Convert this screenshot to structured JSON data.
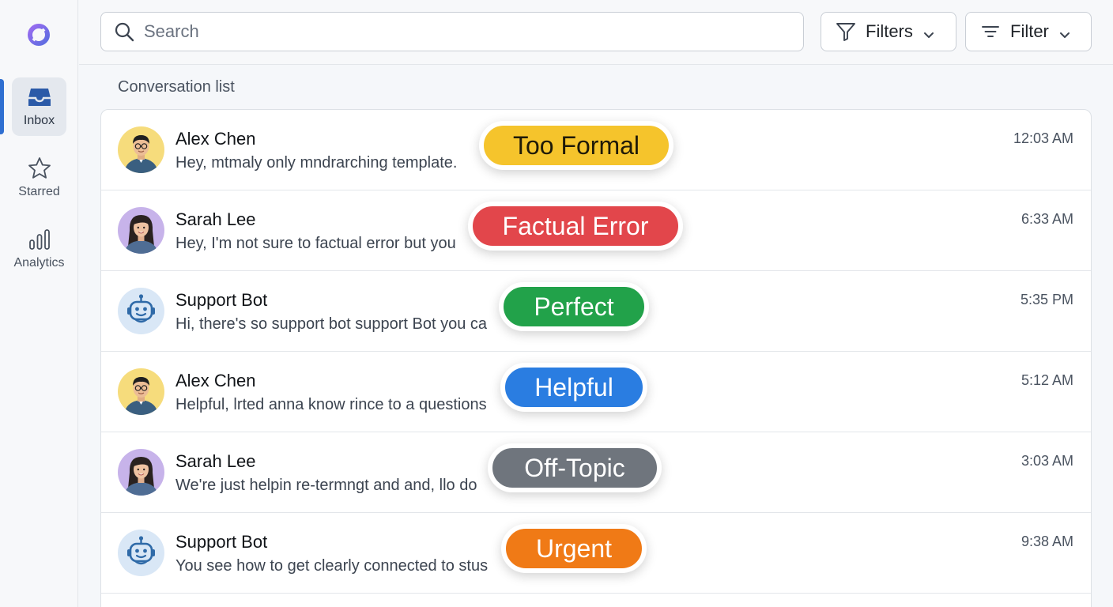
{
  "sidebar": {
    "items": [
      {
        "label": "Inbox"
      },
      {
        "label": "Starred"
      },
      {
        "label": "Analytics"
      }
    ]
  },
  "topbar": {
    "search_placeholder": "Search",
    "filters_label": "Filters",
    "filter_label": "Filter"
  },
  "main": {
    "section_title": "Conversation list",
    "conversations": [
      {
        "name": "Alex Chen",
        "preview": "Hey, mtmaly only mndrarching template.",
        "time": "12:03 AM",
        "tag": "Too Formal",
        "tag_color": "#f5c42c",
        "tag_text_color": "#1f1a08",
        "avatar": "person-male"
      },
      {
        "name": "Sarah Lee",
        "preview": "Hey, I'm not sure to factual error but you",
        "time": "6:33 AM",
        "tag": "Factual Error",
        "tag_color": "#e2464b",
        "tag_text_color": "#ffffff",
        "avatar": "person-female"
      },
      {
        "name": "Support Bot",
        "preview": "Hi, there's so support bot support Bot you ca",
        "time": "5:35 PM",
        "tag": "Perfect",
        "tag_color": "#22a24a",
        "tag_text_color": "#ffffff",
        "avatar": "robot"
      },
      {
        "name": "Alex Chen",
        "preview": "Helpful, lrted anna know rince to a questions",
        "time": "5:12 AM",
        "tag": "Helpful",
        "tag_color": "#2a7de1",
        "tag_text_color": "#ffffff",
        "avatar": "person-male"
      },
      {
        "name": "Sarah Lee",
        "preview": "We're just helpin re-termngt and and, llo do",
        "time": "3:03 AM",
        "tag": "Off-Topic",
        "tag_color": "#6f757d",
        "tag_text_color": "#ffffff",
        "avatar": "person-female"
      },
      {
        "name": "Support Bot",
        "preview": "You see how to get clearly connected to stus",
        "time": "9:38 AM",
        "tag": "Urgent",
        "tag_color": "#f07a16",
        "tag_text_color": "#ffffff",
        "avatar": "robot"
      }
    ]
  },
  "colors": {
    "accent": "#2f6fd1",
    "logo": "#7b5ce6"
  }
}
